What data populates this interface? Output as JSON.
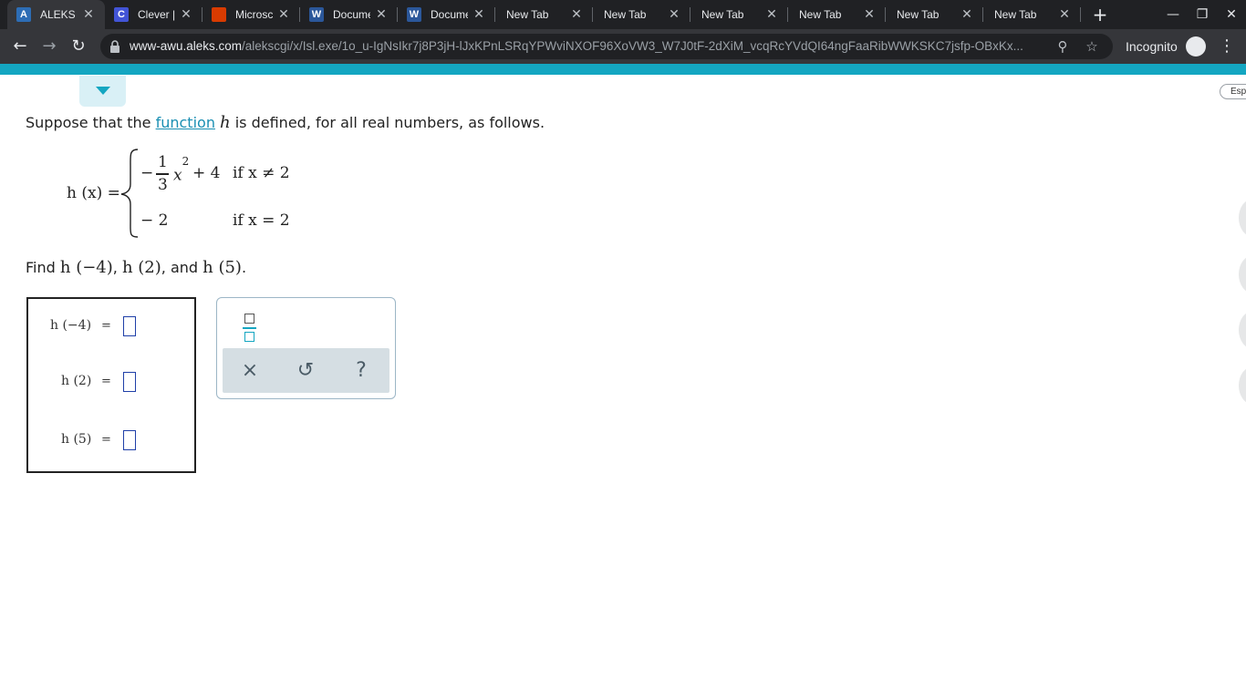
{
  "browser": {
    "tabs": [
      {
        "label": "ALEKS -",
        "icon": "aleks-icon",
        "icon_text": "A",
        "icon_color": "#2d6db5",
        "active": true
      },
      {
        "label": "Clever |",
        "icon": "clever-icon",
        "icon_text": "C",
        "icon_color": "#4254d6",
        "active": false
      },
      {
        "label": "Microsc",
        "icon": "office-icon",
        "icon_text": "",
        "icon_color": "#d83b01",
        "active": false
      },
      {
        "label": "Docume",
        "icon": "word-icon",
        "icon_text": "W",
        "icon_color": "#2b579a",
        "active": false
      },
      {
        "label": "Docume",
        "icon": "word-icon",
        "icon_text": "W",
        "icon_color": "#2b579a",
        "active": false
      },
      {
        "label": "New Tab",
        "icon": "",
        "icon_text": "",
        "icon_color": "",
        "active": false
      },
      {
        "label": "New Tab",
        "icon": "",
        "icon_text": "",
        "icon_color": "",
        "active": false
      },
      {
        "label": "New Tab",
        "icon": "",
        "icon_text": "",
        "icon_color": "",
        "active": false
      },
      {
        "label": "New Tab",
        "icon": "",
        "icon_text": "",
        "icon_color": "",
        "active": false
      },
      {
        "label": "New Tab",
        "icon": "",
        "icon_text": "",
        "icon_color": "",
        "active": false
      },
      {
        "label": "New Tab",
        "icon": "",
        "icon_text": "",
        "icon_color": "",
        "active": false
      }
    ],
    "url_host": "www-awu.aleks.com",
    "url_path": "/alekscgi/x/Isl.exe/1o_u-IgNsIkr7j8P3jH-lJxKPnLSRqYPWviNXOF96XoVW3_W7J0tF-2dXiM_vcqRcYVdQI64ngFaaRibWWKSKC7jsfp-OBxKx...",
    "incognito_label": "Incognito"
  },
  "page": {
    "esp_label": "Esp",
    "intro": {
      "prefix": "Suppose that the ",
      "link": "function",
      "var": "h",
      "suffix": " is defined, for all real numbers, as follows."
    },
    "formula": {
      "lhs": "h (x) =",
      "row1_sign": "−",
      "row1_num": "1",
      "row1_den": "3",
      "row1_var": "x",
      "row1_exp": "2",
      "row1_rest": "+ 4",
      "row1_cond": "if  x ≠ 2",
      "row2_value": "− 2",
      "row2_cond": "if  x = 2"
    },
    "question": {
      "prefix": "Find ",
      "expr1": "h (−4)",
      "sep1": ", ",
      "expr2": "h (2)",
      "sep2": ", and ",
      "expr3": "h (5)",
      "suffix": "."
    },
    "answers": [
      {
        "label": "h (−4)",
        "eq": "=",
        "value": ""
      },
      {
        "label": "h (2)",
        "eq": "=",
        "value": ""
      },
      {
        "label": "h (5)",
        "eq": "=",
        "value": ""
      }
    ],
    "keypad": {
      "clear_glyph": "×",
      "undo_glyph": "↺",
      "help_glyph": "?"
    }
  }
}
